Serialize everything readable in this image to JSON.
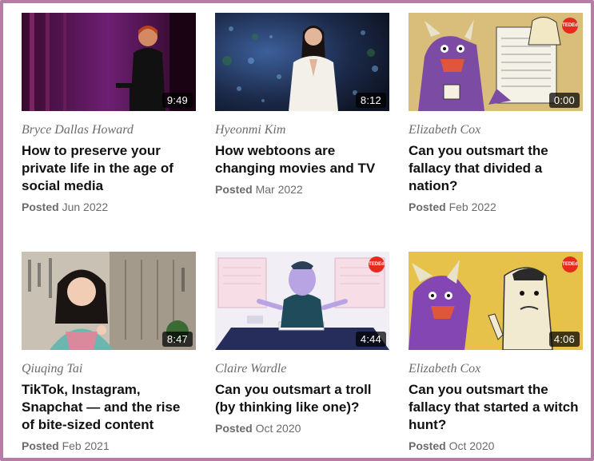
{
  "videos": [
    {
      "speaker": "Bryce Dallas Howard",
      "title": "How to preserve your private life in the age of social media",
      "posted_label": "Posted",
      "date": "Jun 2022",
      "duration": "9:49",
      "thumb_icon": "speaker-on-stage-thumbnail"
    },
    {
      "speaker": "Hyeonmi Kim",
      "title": "How webtoons are changing movies and TV",
      "posted_label": "Posted",
      "date": "Mar 2022",
      "duration": "8:12",
      "thumb_icon": "speaker-on-stage-thumbnail"
    },
    {
      "speaker": "Elizabeth Cox",
      "title": "Can you outsmart the fallacy that divided a nation?",
      "posted_label": "Posted",
      "date": "Feb 2022",
      "duration": "0:00",
      "thumb_icon": "animated-monster-thumbnail"
    },
    {
      "speaker": "Qiuqing Tai",
      "title": "TikTok, Instagram, Snapchat — and the rise of bite-sized content",
      "posted_label": "Posted",
      "date": "Feb 2021",
      "duration": "8:47",
      "thumb_icon": "portrait-thumbnail"
    },
    {
      "speaker": "Claire Wardle",
      "title": "Can you outsmart a troll (by thinking like one)?",
      "posted_label": "Posted",
      "date": "Oct 2020",
      "duration": "4:44",
      "thumb_icon": "animated-computer-thumbnail"
    },
    {
      "speaker": "Elizabeth Cox",
      "title": "Can you outsmart the fallacy that started a witch hunt?",
      "posted_label": "Posted",
      "date": "Oct 2020",
      "duration": "4:06",
      "thumb_icon": "animated-monster-thumbnail"
    }
  ],
  "badge_text": "TEDEd",
  "colors": {
    "frame": "#b77ca6",
    "ted_red": "#e62b1e"
  }
}
